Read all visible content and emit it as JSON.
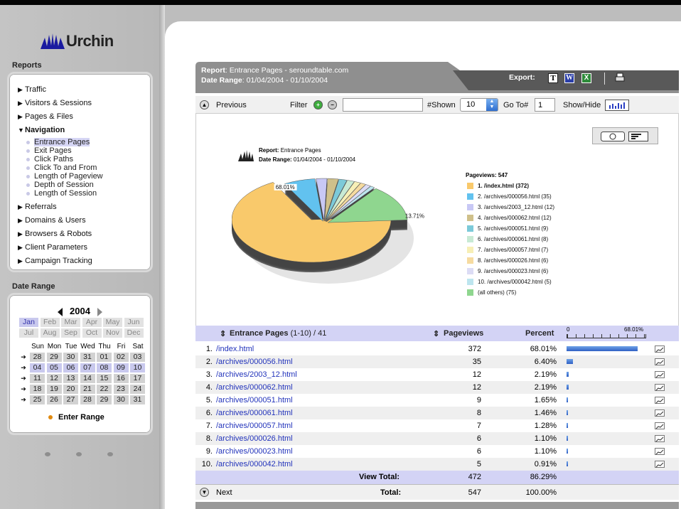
{
  "brand": {
    "name": "Urchin"
  },
  "sidebar": {
    "reports_title": "Reports",
    "items": [
      {
        "label": "Traffic",
        "expanded": false
      },
      {
        "label": "Visitors & Sessions",
        "expanded": false
      },
      {
        "label": "Pages & Files",
        "expanded": false
      },
      {
        "label": "Navigation",
        "expanded": true
      },
      {
        "label": "Referrals",
        "expanded": false
      },
      {
        "label": "Domains & Users",
        "expanded": false
      },
      {
        "label": "Browsers & Robots",
        "expanded": false
      },
      {
        "label": "Client Parameters",
        "expanded": false
      },
      {
        "label": "Campaign Tracking",
        "expanded": false
      }
    ],
    "navigation_sub": [
      "Entrance Pages",
      "Exit Pages",
      "Click Paths",
      "Click To and From",
      "Length of Pageview",
      "Depth of Session",
      "Length of Session"
    ],
    "selected_sub": "Entrance Pages"
  },
  "date_range": {
    "title": "Date Range",
    "year": "2004",
    "months": [
      "Jan",
      "Feb",
      "Mar",
      "Apr",
      "May",
      "Jun",
      "Jul",
      "Aug",
      "Sep",
      "Oct",
      "Nov",
      "Dec"
    ],
    "selected_month": "Jan",
    "weekdays": [
      "Sun",
      "Mon",
      "Tue",
      "Wed",
      "Thu",
      "Fri",
      "Sat"
    ],
    "weeks": [
      [
        "28",
        "29",
        "30",
        "31",
        "01",
        "02",
        "03"
      ],
      [
        "04",
        "05",
        "06",
        "07",
        "08",
        "09",
        "10"
      ],
      [
        "11",
        "12",
        "13",
        "14",
        "15",
        "16",
        "17"
      ],
      [
        "18",
        "19",
        "20",
        "21",
        "22",
        "23",
        "24"
      ],
      [
        "25",
        "26",
        "27",
        "28",
        "29",
        "30",
        "31"
      ]
    ],
    "highlighted_week": 1,
    "enter_range_label": "Enter Range"
  },
  "report_header": {
    "report_label": "Report",
    "report_value": "Entrance Pages - seroundtable.com",
    "range_label": "Date Range",
    "range_value": "01/04/2004 - 01/10/2004",
    "export_label": "Export:",
    "export_icons": [
      "T",
      "W",
      "X"
    ]
  },
  "toolbar": {
    "previous_label": "Previous",
    "filter_label": "Filter",
    "filter_value": "",
    "shown_label": "#Shown",
    "shown_value": "10",
    "goto_label": "Go To#",
    "goto_value": "1",
    "showhide_label": "Show/Hide"
  },
  "chart_caption": {
    "report_label": "Report:",
    "report_value": "Entrance Pages",
    "range_label": "Date Range:",
    "range_value": "01/04/2004 - 01/10/2004",
    "legend_title": "Pageviews: 547"
  },
  "chart_data": {
    "type": "pie",
    "title": "Pageviews: 547",
    "categories": [
      "1. /index.html (372)",
      "2. /archives/000056.html (35)",
      "3. /archives/2003_12.html (12)",
      "4. /archives/000062.html (12)",
      "5. /archives/000051.html (9)",
      "6. /archives/000061.html (8)",
      "7. /archives/000057.html (7)",
      "8. /archives/000026.html (6)",
      "9. /archives/000023.html (6)",
      "10. /archives/000042.html (5)",
      "(all others) (75)"
    ],
    "values": [
      372,
      35,
      12,
      12,
      9,
      8,
      7,
      6,
      6,
      5,
      75
    ],
    "colors": [
      "#f9c96b",
      "#62c2ef",
      "#c8c8f5",
      "#cfc08a",
      "#7ccad9",
      "#c8ead4",
      "#f7efb6",
      "#f6dba0",
      "#dcdcf5",
      "#bde5ef",
      "#8fd68f"
    ],
    "slice_labels": [
      {
        "index": 0,
        "text": "68.01%"
      },
      {
        "index": 10,
        "text": "13.71%"
      }
    ]
  },
  "table": {
    "headers": {
      "page": "Entrance Pages",
      "range": "(1-10) / 41",
      "pageviews": "Pageviews",
      "percent": "Percent",
      "scale_min": "0",
      "scale_max": "68.01%"
    },
    "rows": [
      {
        "n": "1.",
        "page": "/index.html",
        "pv": "372",
        "pct": "68.01%",
        "frac": 1.0
      },
      {
        "n": "2.",
        "page": "/archives/000056.html",
        "pv": "35",
        "pct": "6.40%",
        "frac": 0.094
      },
      {
        "n": "3.",
        "page": "/archives/2003_12.html",
        "pv": "12",
        "pct": "2.19%",
        "frac": 0.032
      },
      {
        "n": "4.",
        "page": "/archives/000062.html",
        "pv": "12",
        "pct": "2.19%",
        "frac": 0.032
      },
      {
        "n": "5.",
        "page": "/archives/000051.html",
        "pv": "9",
        "pct": "1.65%",
        "frac": 0.024
      },
      {
        "n": "6.",
        "page": "/archives/000061.html",
        "pv": "8",
        "pct": "1.46%",
        "frac": 0.021
      },
      {
        "n": "7.",
        "page": "/archives/000057.html",
        "pv": "7",
        "pct": "1.28%",
        "frac": 0.019
      },
      {
        "n": "8.",
        "page": "/archives/000026.html",
        "pv": "6",
        "pct": "1.10%",
        "frac": 0.016
      },
      {
        "n": "9.",
        "page": "/archives/000023.html",
        "pv": "6",
        "pct": "1.10%",
        "frac": 0.016
      },
      {
        "n": "10.",
        "page": "/archives/000042.html",
        "pv": "5",
        "pct": "0.91%",
        "frac": 0.013
      }
    ],
    "view_total": {
      "label": "View Total:",
      "pv": "472",
      "pct": "86.29%"
    },
    "total": {
      "label": "Total:",
      "pv": "547",
      "pct": "100.00%"
    },
    "next_label": "Next"
  }
}
